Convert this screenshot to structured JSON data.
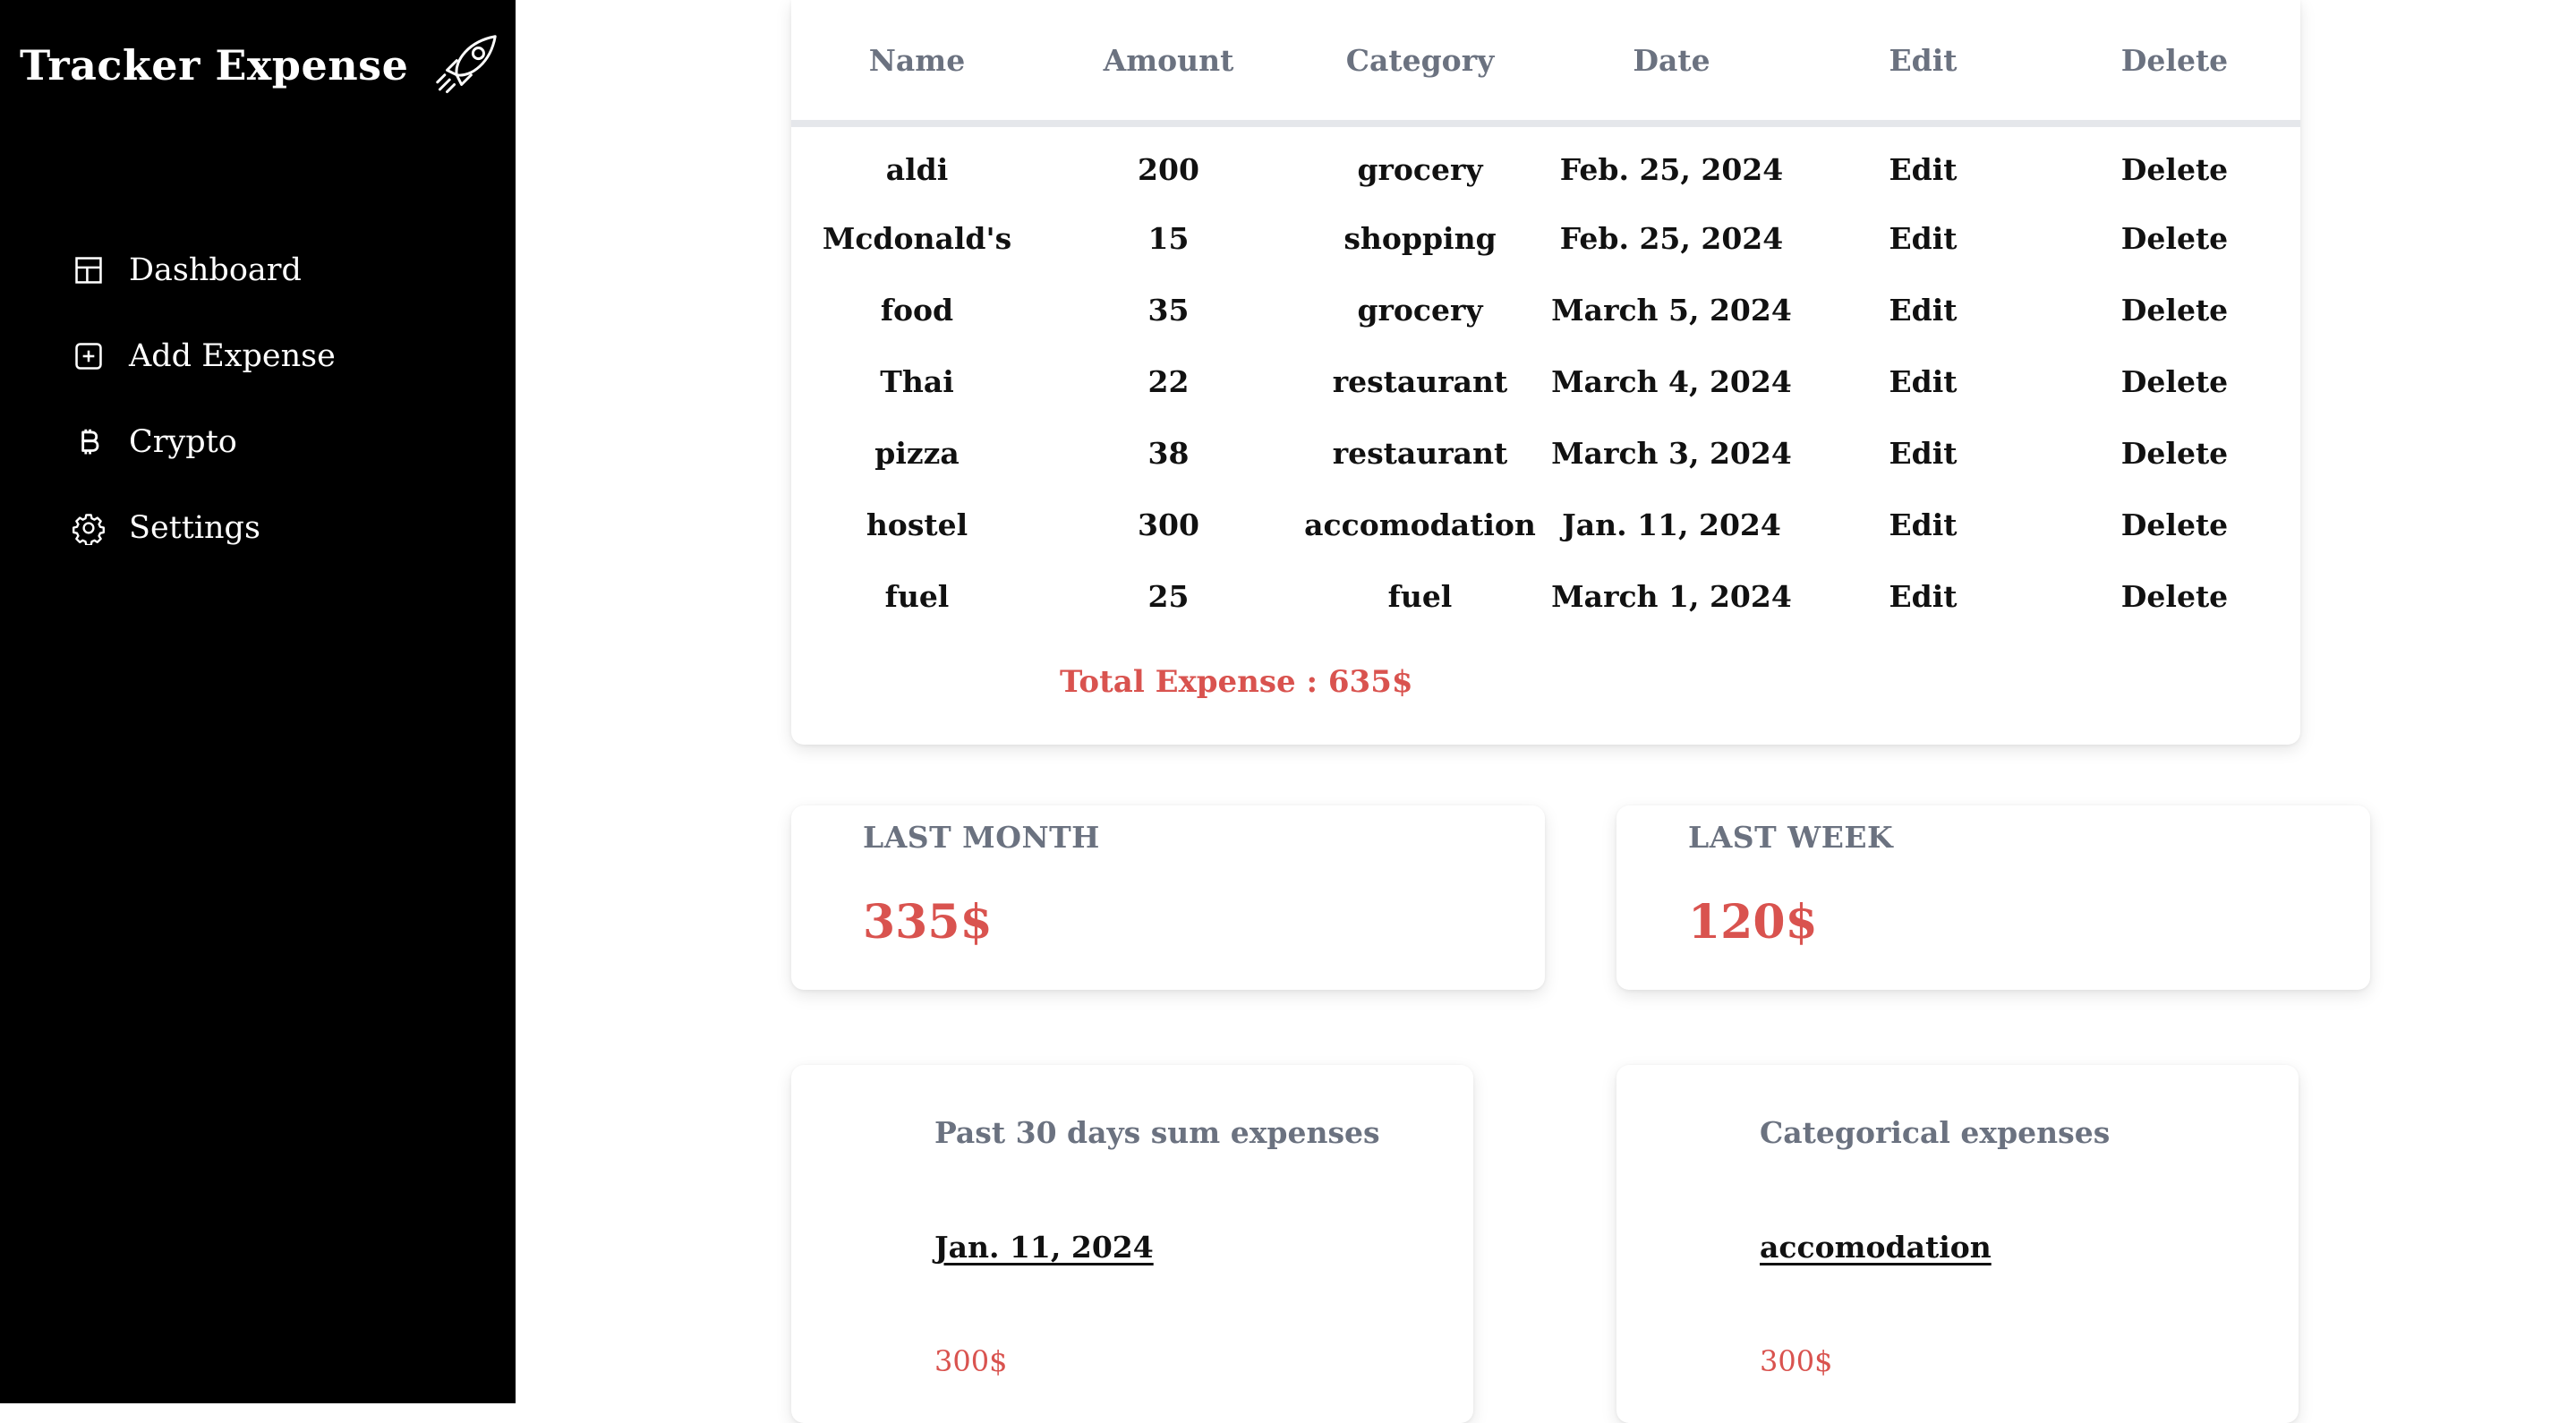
{
  "app": {
    "title": "Tracker Expense",
    "brand_icon": "rocket-icon"
  },
  "sidebar": {
    "items": [
      {
        "label": "Dashboard",
        "icon": "layout-grid-icon"
      },
      {
        "label": "Add Expense",
        "icon": "plus-square-icon"
      },
      {
        "label": "Crypto",
        "icon": "bitcoin-icon"
      },
      {
        "label": "Settings",
        "icon": "gear-icon"
      }
    ]
  },
  "expenses": {
    "columns": [
      "Name",
      "Amount",
      "Category",
      "Date",
      "Edit",
      "Delete"
    ],
    "rows": [
      {
        "name": "aldi",
        "amount": "200",
        "category": "grocery",
        "date": "Feb. 25, 2024",
        "edit": "Edit",
        "delete": "Delete"
      },
      {
        "name": "Mcdonald's",
        "amount": "15",
        "category": "shopping",
        "date": "Feb. 25, 2024",
        "edit": "Edit",
        "delete": "Delete"
      },
      {
        "name": "food",
        "amount": "35",
        "category": "grocery",
        "date": "March 5, 2024",
        "edit": "Edit",
        "delete": "Delete"
      },
      {
        "name": "Thai",
        "amount": "22",
        "category": "restaurant",
        "date": "March 4, 2024",
        "edit": "Edit",
        "delete": "Delete"
      },
      {
        "name": "pizza",
        "amount": "38",
        "category": "restaurant",
        "date": "March 3, 2024",
        "edit": "Edit",
        "delete": "Delete"
      },
      {
        "name": "hostel",
        "amount": "300",
        "category": "accomodation",
        "date": "Jan. 11, 2024",
        "edit": "Edit",
        "delete": "Delete"
      },
      {
        "name": "fuel",
        "amount": "25",
        "category": "fuel",
        "date": "March 1, 2024",
        "edit": "Edit",
        "delete": "Delete"
      }
    ],
    "total_label": "Total Expense : 635$"
  },
  "stats": {
    "last_month": {
      "label": "LAST MONTH",
      "value": "335$"
    },
    "last_week": {
      "label": "LAST WEEK",
      "value": "120$"
    }
  },
  "summaries": {
    "past_30_days": {
      "title": "Past 30 days sum expenses",
      "key": "Jan. 11, 2024",
      "value": "300$"
    },
    "categorical": {
      "title": "Categorical expenses",
      "key": "accomodation",
      "value": "300$"
    }
  },
  "colors": {
    "sidebar_bg": "#000000",
    "accent_red": "#d9534f",
    "muted_text": "#6b7280"
  }
}
